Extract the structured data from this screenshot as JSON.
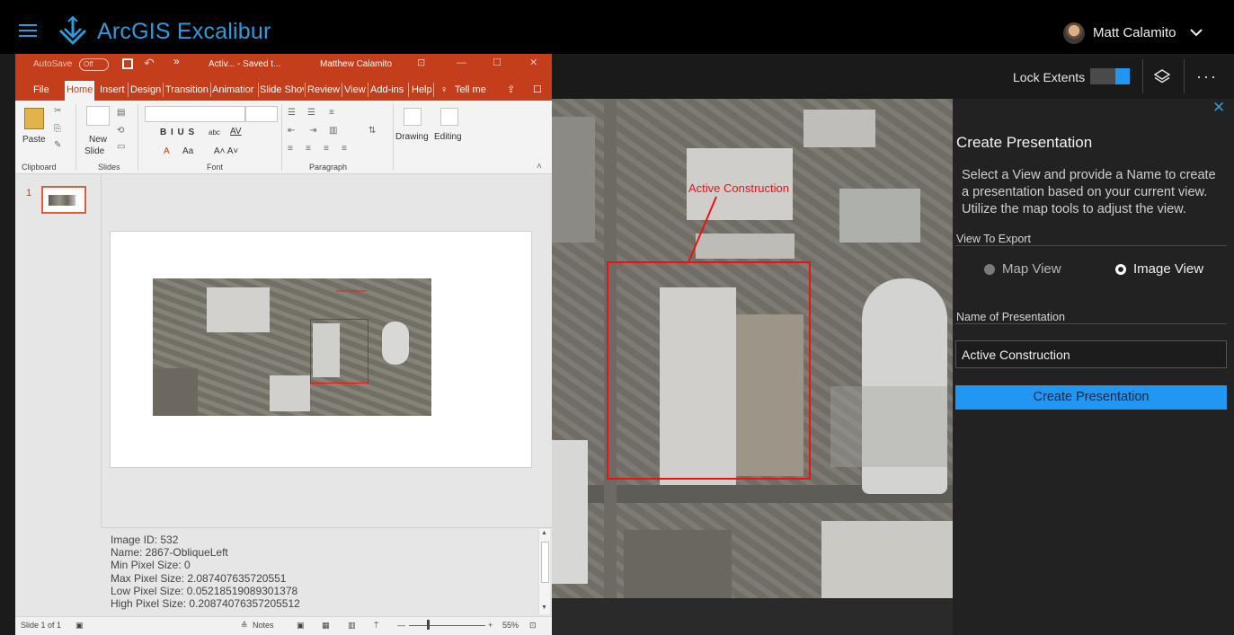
{
  "app": {
    "title": "ArcGIS Excalibur",
    "user_name": "Matt Calamito"
  },
  "toolbar": {
    "lock_extents_label": "Lock Extents",
    "lock_extents_on": true
  },
  "map": {
    "annotation_label": "Active Construction"
  },
  "panel": {
    "close_glyph": "✕",
    "title": "Create Presentation",
    "description": "Select a View and provide a Name to create a presentation based on your current view. Utilize the map tools to adjust the view.",
    "view_section_label": "View To Export",
    "options": [
      {
        "label": "Map View",
        "selected": false
      },
      {
        "label": "Image View",
        "selected": true
      }
    ],
    "name_section_label": "Name of Presentation",
    "name_value": "Active Construction",
    "create_button_label": "Create Presentation"
  },
  "ppt": {
    "autosave_label": "AutoSave",
    "autosave_state": "Off",
    "doc_title": "Activ... - Saved t...",
    "user": "Matthew Calamito",
    "tabs": [
      "File",
      "Home",
      "Insert",
      "Design",
      "Transition",
      "Animatior",
      "Slide Shov",
      "Review",
      "View",
      "Add-ins",
      "Help",
      "Tell me"
    ],
    "active_tab": "Home",
    "ribbon": {
      "clipboard_group": "Clipboard",
      "slides_group": "Slides",
      "font_group": "Font",
      "paragraph_group": "Paragraph",
      "paste": "Paste",
      "new_slide_1": "New",
      "new_slide_2": "Slide",
      "drawing": "Drawing",
      "editing": "Editing",
      "font_buttons": "B  I  U  S",
      "abc": "abc",
      "av": "AV",
      "aa": "Aa",
      "font_size_up_down": "A˄ A˅",
      "font_color": "A"
    },
    "slide_number": "1",
    "notes_lines": [
      "Image ID:  532",
      "Name:  2867-ObliqueLeft",
      "Min Pixel Size:  0",
      "Max Pixel Size:  2.087407635720551",
      "Low Pixel Size:  0.05218519089301378",
      "High Pixel Size:  0.20874076357205512"
    ],
    "status": {
      "slide_count": "Slide 1 of 1",
      "notes_button": "Notes",
      "zoom": "55%"
    }
  },
  "colors": {
    "accent": "#2d9cdb",
    "ppt_brand": "#c43e1c",
    "annotation": "#ee1111",
    "button": "#2196f3"
  }
}
